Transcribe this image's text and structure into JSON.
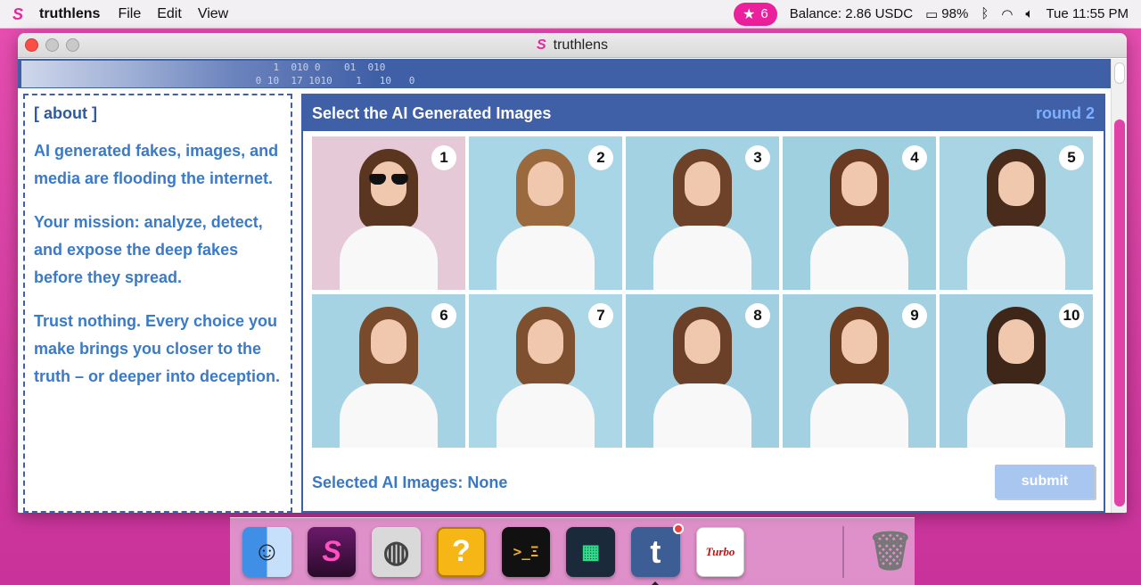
{
  "menubar": {
    "app_name": "truthlens",
    "menus": [
      "File",
      "Edit",
      "View"
    ],
    "star_count": "6",
    "balance": "Balance:  2.86 USDC",
    "battery": "98%",
    "clock": "Tue 11:55 PM"
  },
  "window": {
    "title": "truthlens",
    "banner_binary": "    1  010 0    01  010\n 0 10  17 1010    1   10   0"
  },
  "about": {
    "title": "[ about ]",
    "paragraphs": [
      "AI generated fakes, images, and media are flooding the internet.",
      "Your mission: analyze, detect, and expose the deep fakes before they spread.",
      "Trust nothing. Every choice you make brings you closer to the truth – or deeper into deception."
    ]
  },
  "game": {
    "title": "Select the AI Generated Images",
    "round": "round 2",
    "tiles": [
      {
        "num": "1",
        "bg": "#e6c9d6",
        "hair": "#5a3520",
        "glasses": true
      },
      {
        "num": "2",
        "bg": "#a9d6e6",
        "hair": "#9a6a3e",
        "glasses": false
      },
      {
        "num": "3",
        "bg": "#a3d2e2",
        "hair": "#6e4228",
        "glasses": false
      },
      {
        "num": "4",
        "bg": "#9fd0e0",
        "hair": "#6a3a22",
        "glasses": false
      },
      {
        "num": "5",
        "bg": "#a8d4e4",
        "hair": "#4a2c1c",
        "glasses": false
      },
      {
        "num": "6",
        "bg": "#a6d3e3",
        "hair": "#7a4a2c",
        "glasses": false
      },
      {
        "num": "7",
        "bg": "#acd7e6",
        "hair": "#7e5030",
        "glasses": false
      },
      {
        "num": "8",
        "bg": "#9fcfe0",
        "hair": "#6a4028",
        "glasses": false
      },
      {
        "num": "9",
        "bg": "#a4d1e2",
        "hair": "#6e3e22",
        "glasses": false
      },
      {
        "num": "10",
        "bg": "#a2d0e2",
        "hair": "#3e2618",
        "glasses": false
      }
    ],
    "selected_label": "Selected AI Images: None",
    "submit_label": "submit"
  },
  "dock": {
    "turbo_label": "Turbo"
  }
}
